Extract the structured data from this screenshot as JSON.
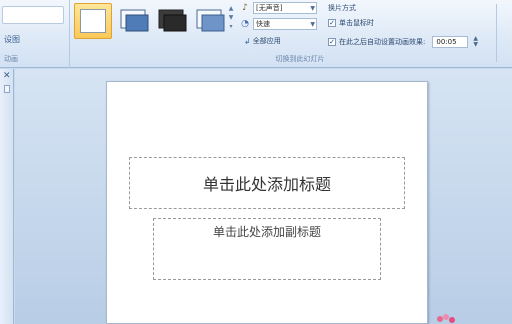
{
  "ribbon": {
    "left_label": "设图",
    "left_group_label": "动画",
    "sound_value": "[无声音]",
    "speed_value": "快速",
    "apply_all_label": "全部应用",
    "transition_group_label": "切换到此幻灯片",
    "advance_title": "换片方式",
    "on_click_label": "单击鼠标时",
    "auto_after_label": "在此之后自动设置动画效果:",
    "auto_after_time": "00:05"
  },
  "slide": {
    "title_placeholder": "单击此处添加标题",
    "subtitle_placeholder": "单击此处添加副标题"
  },
  "colors": {
    "ribbon_bg": "#dfeaf7",
    "workspace_bg": "#c9d9ec",
    "selected_thumb": "#fbc957"
  },
  "icons": [
    "sound-icon",
    "speed-icon",
    "apply-all-icon",
    "close-icon"
  ]
}
